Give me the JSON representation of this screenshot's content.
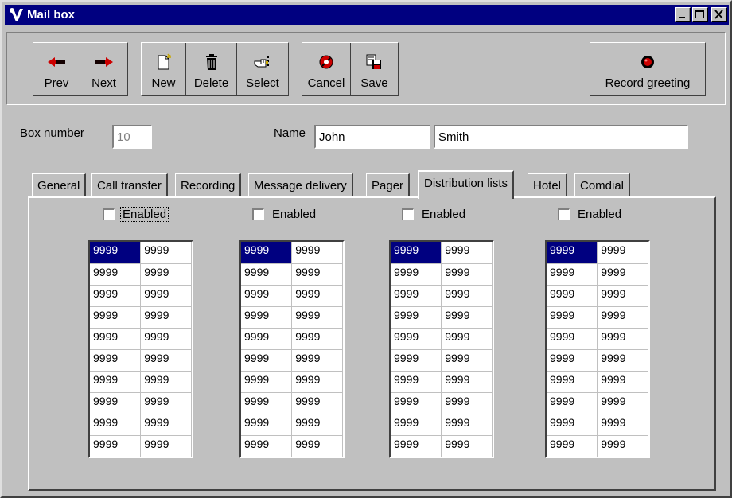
{
  "window": {
    "title": "Mail box"
  },
  "toolbar": {
    "prev": "Prev",
    "next": "Next",
    "new": "New",
    "delete": "Delete",
    "select": "Select",
    "cancel": "Cancel",
    "save": "Save",
    "record": "Record greeting"
  },
  "form": {
    "box_number_label": "Box number",
    "box_number_value": "10",
    "name_label": "Name",
    "first_name": "John",
    "last_name": "Smith"
  },
  "tabs": [
    "General",
    "Call transfer",
    "Recording",
    "Message delivery",
    "Pager",
    "Distribution lists",
    "Hotel",
    "Comdial"
  ],
  "active_tab": "Distribution lists",
  "distribution_lists": [
    {
      "enabled_label": "Enabled",
      "enabled": false,
      "rows": [
        [
          "9999",
          "9999"
        ],
        [
          "9999",
          "9999"
        ],
        [
          "9999",
          "9999"
        ],
        [
          "9999",
          "9999"
        ],
        [
          "9999",
          "9999"
        ],
        [
          "9999",
          "9999"
        ],
        [
          "9999",
          "9999"
        ],
        [
          "9999",
          "9999"
        ],
        [
          "9999",
          "9999"
        ],
        [
          "9999",
          "9999"
        ]
      ]
    },
    {
      "enabled_label": "Enabled",
      "enabled": false,
      "rows": [
        [
          "9999",
          "9999"
        ],
        [
          "9999",
          "9999"
        ],
        [
          "9999",
          "9999"
        ],
        [
          "9999",
          "9999"
        ],
        [
          "9999",
          "9999"
        ],
        [
          "9999",
          "9999"
        ],
        [
          "9999",
          "9999"
        ],
        [
          "9999",
          "9999"
        ],
        [
          "9999",
          "9999"
        ],
        [
          "9999",
          "9999"
        ]
      ]
    },
    {
      "enabled_label": "Enabled",
      "enabled": false,
      "rows": [
        [
          "9999",
          "9999"
        ],
        [
          "9999",
          "9999"
        ],
        [
          "9999",
          "9999"
        ],
        [
          "9999",
          "9999"
        ],
        [
          "9999",
          "9999"
        ],
        [
          "9999",
          "9999"
        ],
        [
          "9999",
          "9999"
        ],
        [
          "9999",
          "9999"
        ],
        [
          "9999",
          "9999"
        ],
        [
          "9999",
          "9999"
        ]
      ]
    },
    {
      "enabled_label": "Enabled",
      "enabled": false,
      "rows": [
        [
          "9999",
          "9999"
        ],
        [
          "9999",
          "9999"
        ],
        [
          "9999",
          "9999"
        ],
        [
          "9999",
          "9999"
        ],
        [
          "9999",
          "9999"
        ],
        [
          "9999",
          "9999"
        ],
        [
          "9999",
          "9999"
        ],
        [
          "9999",
          "9999"
        ],
        [
          "9999",
          "9999"
        ],
        [
          "9999",
          "9999"
        ]
      ]
    }
  ],
  "icons": {
    "app": "app-v-icon",
    "minimize": "minimize-icon",
    "maximize": "maximize-icon",
    "close": "close-icon",
    "prev": "arrow-left-icon",
    "next": "arrow-right-icon",
    "new": "new-document-icon",
    "delete": "trash-icon",
    "select": "pointing-hand-icon",
    "cancel": "stop-icon",
    "save": "save-icon",
    "record": "record-dot-icon"
  },
  "colors": {
    "titlebar": "#000080",
    "face": "#c0c0c0",
    "selection": "#000080",
    "arrow": "#cc0000"
  }
}
